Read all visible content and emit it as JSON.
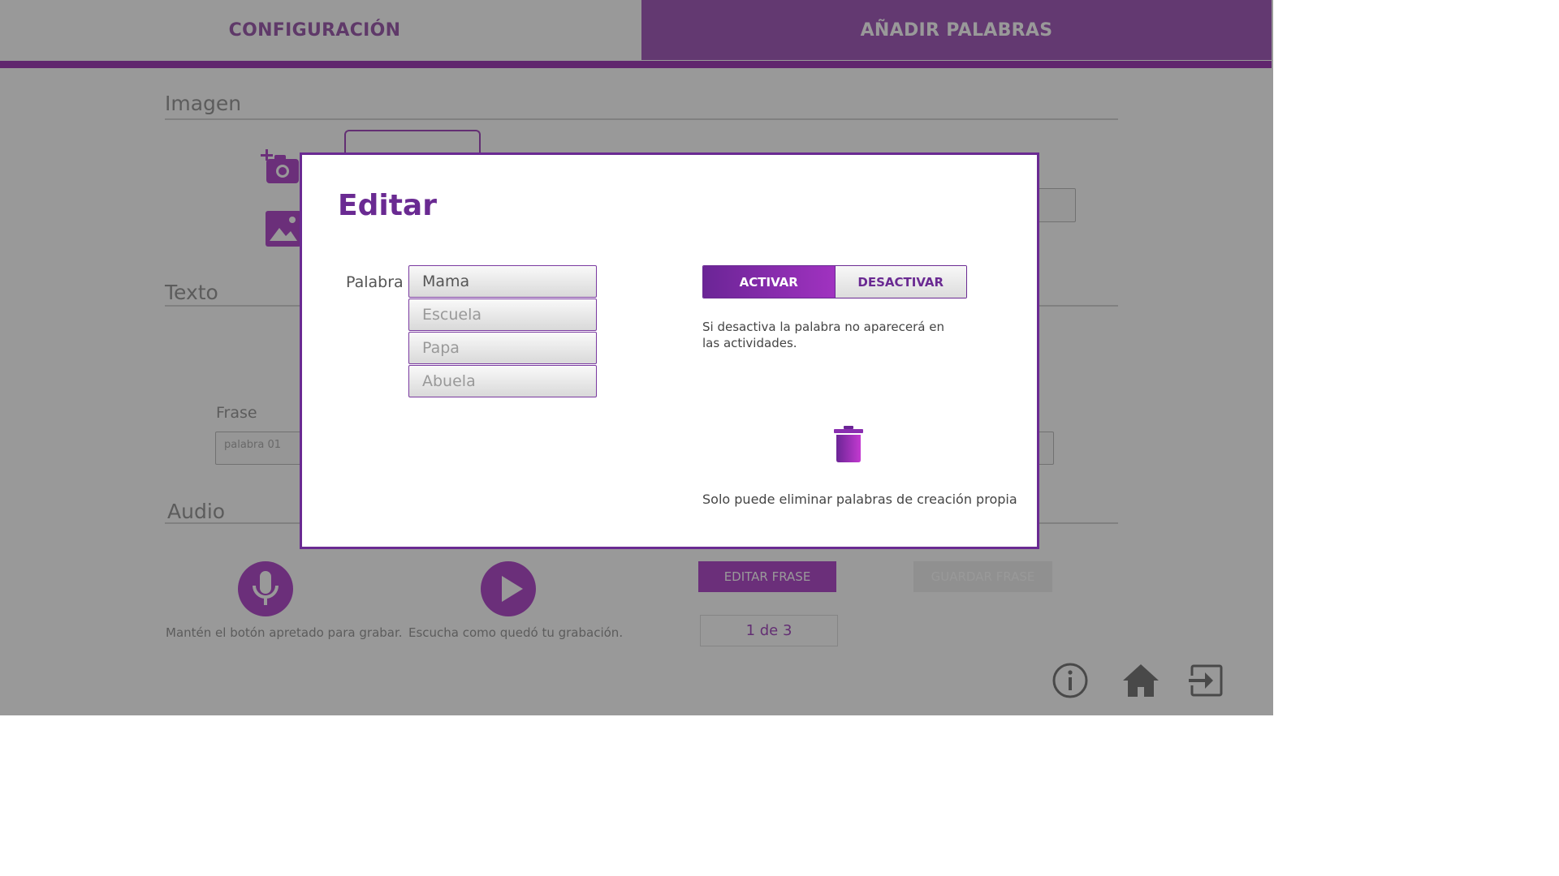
{
  "tabs": {
    "config": "CONFIGURACIÓN",
    "add_words": "AÑADIR PALABRAS"
  },
  "sections": {
    "imagen": "Imagen",
    "texto": "Texto",
    "audio": "Audio"
  },
  "texto": {
    "frase_label": "Frase",
    "frase_placeholder": "palabra 01"
  },
  "audio": {
    "record_caption": "Mantén el botón apretado para grabar.",
    "play_caption": "Escucha como quedó tu grabación."
  },
  "actions": {
    "edit_phrase": "EDITAR FRASE",
    "save_phrase": "GUARDAR FRASE",
    "page_counter": "1 de 3"
  },
  "footer_icons": [
    "info-icon",
    "home-icon",
    "exit-icon"
  ],
  "modal": {
    "title": "Editar",
    "field_label": "Palabra",
    "words": [
      "Mama",
      "Escuela",
      "Papa",
      "Abuela"
    ],
    "selected_word": "Mama",
    "toggle": {
      "activate": "ACTIVAR",
      "deactivate": "DESACTIVAR",
      "active": "ACTIVAR"
    },
    "note": "Si desactiva la palabra no aparecerá en las actividades.",
    "delete_note": "Solo puede eliminar palabras de creación propia"
  },
  "colors": {
    "accent": "#6a2a92",
    "accent_light": "#a64fc0",
    "overlay": "rgba(0,0,0,0.40)"
  }
}
